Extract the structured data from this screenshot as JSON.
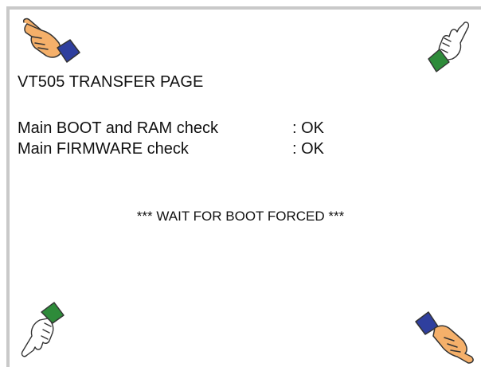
{
  "screen": {
    "title": "VT505 TRANSFER PAGE",
    "checks": [
      {
        "label": "Main BOOT and RAM check",
        "status": ": OK"
      },
      {
        "label": "Main FIRMWARE check",
        "status": ": OK"
      }
    ],
    "wait_message": "*** WAIT FOR BOOT FORCED ***"
  },
  "icons": {
    "top_left": "pointing-hand-icon",
    "top_right": "pointing-hand-icon",
    "bottom_left": "pointing-hand-icon",
    "bottom_right": "pointing-hand-icon"
  },
  "colors": {
    "filled_hand": "#f5b06a",
    "cuff_blue": "#2f3f9e",
    "cuff_green": "#2e8b3a",
    "outline": "#333333"
  }
}
